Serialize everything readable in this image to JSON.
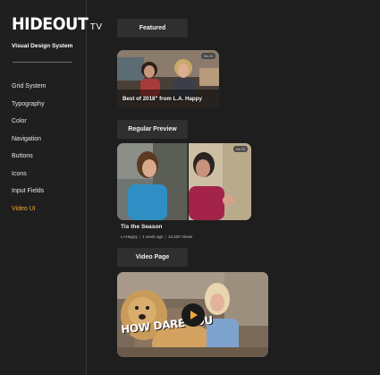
{
  "brand": {
    "logo_main": "HIDEOUT",
    "logo_tv": "TV",
    "subtitle": "Visual Design System"
  },
  "sidebar": {
    "items": [
      {
        "label": "Grid System"
      },
      {
        "label": "Typography"
      },
      {
        "label": "Color"
      },
      {
        "label": "Navigation"
      },
      {
        "label": "Buttons"
      },
      {
        "label": "Icons"
      },
      {
        "label": "Input Fields"
      },
      {
        "label": "Video UI",
        "active": true
      }
    ],
    "active_color": "#f0a83b"
  },
  "featured": {
    "section_label": "Featured",
    "caption": "Best of 2018\" from L.A. Happy",
    "duration": "04:23"
  },
  "regular": {
    "section_label": "Regular Preview",
    "duration": "04:23",
    "title": "Tis the Season",
    "channel": "LAHappy",
    "age": "1 week ago",
    "views": "12,500 Views"
  },
  "video_page": {
    "section_label": "Video Page",
    "overlay_text": "HOW DARE YOU",
    "play_icon": "play-icon",
    "accent": "#f0a83b"
  }
}
